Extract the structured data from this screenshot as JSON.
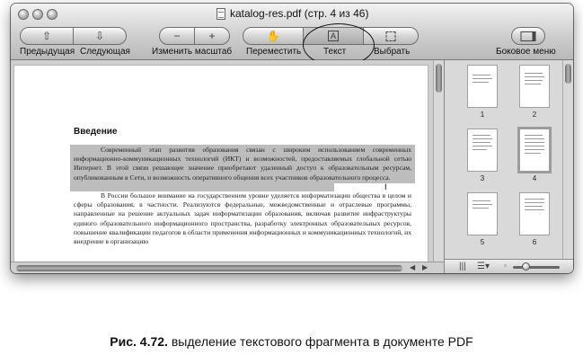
{
  "window": {
    "title": "katalog-res.pdf (стр. 4 из 46)"
  },
  "toolbar": {
    "prev_label": "Предыдущая",
    "next_label": "Следующая",
    "zoom_label": "Изменить масштаб",
    "move_label": "Переместить",
    "text_label": "Текст",
    "select_label": "Выбрать",
    "sidebar_label": "Боковое меню"
  },
  "icons": {
    "prev": "arrow-up-icon",
    "next": "arrow-down-icon",
    "zoom_out": "minus-icon",
    "zoom_in": "plus-icon",
    "move": "hand-icon",
    "text": "text-cursor-icon",
    "select": "marquee-select-icon",
    "sidebar": "sidebar-icon"
  },
  "document": {
    "heading": "Введение",
    "paragraph1": "Современный этап развития образования связан с широким использованием современных информационно-коммуникационных технологий (ИКТ) и возможностей, предоставляемых глобальной сетью Интернет. В этой связи решающее значение приобретают удаленный доступ к образовательным ресурсам, опубликованным в Сети, и возможность оперативного общения всех участников образовательного процесса.",
    "paragraph2": "В России большое внимание на государственном уровне уделяется информатизации общества в целом и сферы образования, в частности. Реализуются федеральные, межведомственные и отраслевые программы, направленные на решение актуальных задач информатизации образования, включая развитие инфраструктуры единого образовательного информационного пространства, разработку электронных образовательных ресурсов, повышение квалификации педагогов в области применения информационных и коммуникационных технологий, их внедрение в организацию"
  },
  "sidebar": {
    "thumbnails": [
      {
        "number": "1"
      },
      {
        "number": "2"
      },
      {
        "number": "3"
      },
      {
        "number": "4"
      },
      {
        "number": "5"
      },
      {
        "number": "6"
      }
    ],
    "selected_page": "4"
  },
  "caption": {
    "prefix": "Рис. 4.72.",
    "text": "выделение текстового фрагмента в документе PDF"
  },
  "colors": {
    "selection": "#bdbdbd",
    "chrome": "#dcdcdc"
  }
}
